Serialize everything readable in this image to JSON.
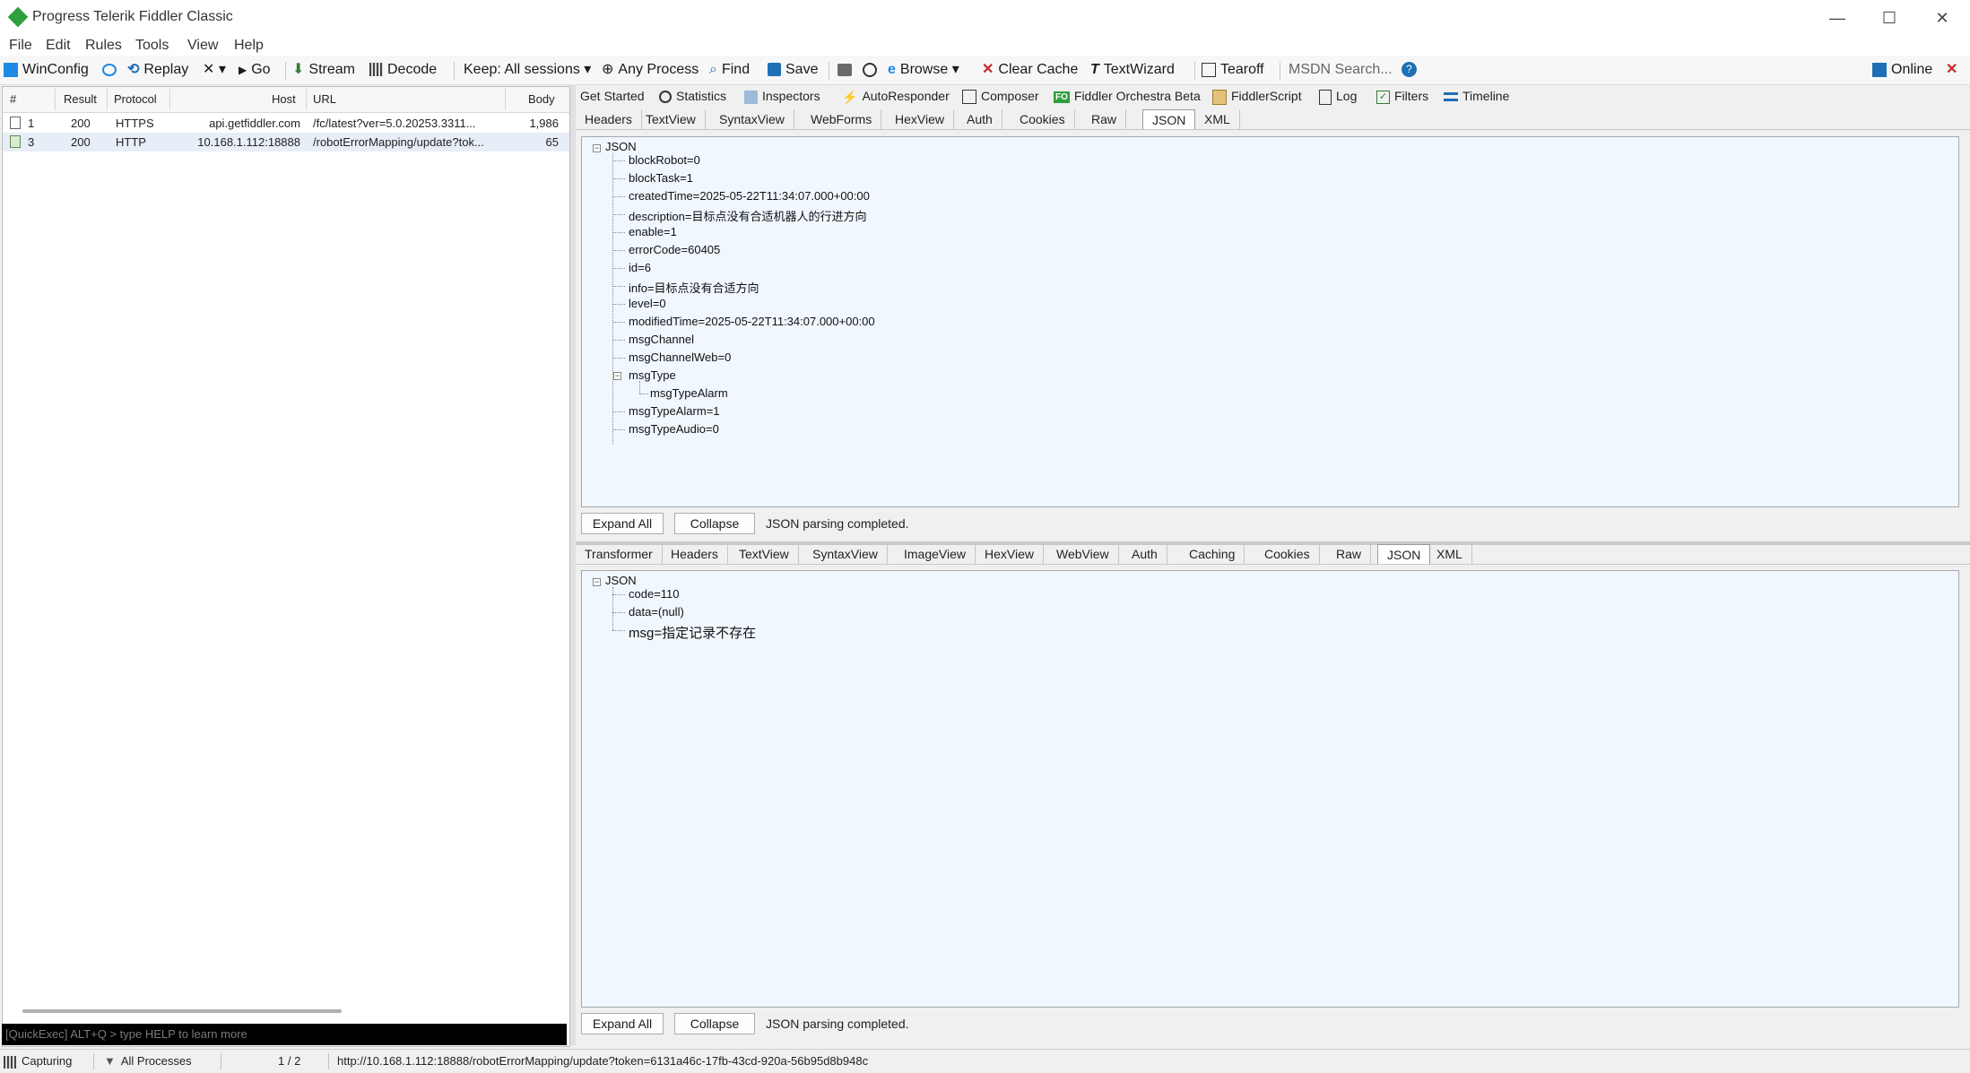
{
  "window": {
    "title": "Progress Telerik Fiddler Classic",
    "minimize": "—",
    "maximize": "☐",
    "close": "✕"
  },
  "menu": [
    "File",
    "Edit",
    "Rules",
    "Tools",
    "View",
    "Help"
  ],
  "toolbar": {
    "winconfig": "WinConfig",
    "replay": "Replay",
    "remove": "✕ ▾",
    "go": "Go",
    "stream": "Stream",
    "decode": "Decode",
    "keep": "Keep: All sessions ▾",
    "any_process": "Any Process",
    "find": "Find",
    "save": "Save",
    "browse": "Browse ▾",
    "clear_cache": "Clear Cache",
    "textwizard": "TextWizard",
    "tearoff": "Tearoff",
    "search_placeholder": "MSDN Search...",
    "online": "Online"
  },
  "sessions": {
    "columns": [
      "#",
      "Result",
      "Protocol",
      "Host",
      "URL",
      "Body"
    ],
    "rows": [
      {
        "num": "1",
        "result": "200",
        "protocol": "HTTPS",
        "host": "api.getfiddler.com",
        "url": "/fc/latest?ver=5.0.20253.3311...",
        "body": "1,986"
      },
      {
        "num": "3",
        "result": "200",
        "protocol": "HTTP",
        "host": "10.168.1.112:18888",
        "url": "/robotErrorMapping/update?tok...",
        "body": "65"
      }
    ],
    "quickexec": "[QuickExec] ALT+Q > type HELP to learn more"
  },
  "main_tabs": [
    "Get Started",
    "Statistics",
    "Inspectors",
    "AutoResponder",
    "Composer",
    "Fiddler Orchestra Beta",
    "FiddlerScript",
    "Log",
    "Filters",
    "Timeline"
  ],
  "fo_badge": "FO",
  "request": {
    "tabs": [
      "Headers",
      "TextView",
      "SyntaxView",
      "WebForms",
      "HexView",
      "Auth",
      "Cookies",
      "Raw",
      "JSON",
      "XML"
    ],
    "root": "JSON",
    "nodes": [
      "blockRobot=0",
      "blockTask=1",
      "createdTime=2025-05-22T11:34:07.000+00:00",
      "description=目标点没有合适机器人的行进方向",
      "enable=1",
      "errorCode=60405",
      "id=6",
      "info=目标点没有合适方向",
      "level=0",
      "modifiedTime=2025-05-22T11:34:07.000+00:00",
      "msgChannel",
      "msgChannelWeb=0",
      "msgType",
      "msgTypeAlarm",
      "msgTypeAlarm=1",
      "msgTypeAudio=0"
    ],
    "expand_all": "Expand All",
    "collapse": "Collapse",
    "status": "JSON parsing completed."
  },
  "response": {
    "tabs": [
      "Transformer",
      "Headers",
      "TextView",
      "SyntaxView",
      "ImageView",
      "HexView",
      "WebView",
      "Auth",
      "Caching",
      "Cookies",
      "Raw",
      "JSON",
      "XML"
    ],
    "root": "JSON",
    "nodes": [
      "code=110",
      "data=(null)",
      "msg=指定记录不存在"
    ],
    "expand_all": "Expand All",
    "collapse": "Collapse",
    "status": "JSON parsing completed."
  },
  "statusbar": {
    "capturing": "Capturing",
    "processes": "All Processes",
    "count": "1 / 2",
    "url": "http://10.168.1.112:18888/robotErrorMapping/update?token=6131a46c-17fb-43cd-920a-56b95d8b948c"
  }
}
